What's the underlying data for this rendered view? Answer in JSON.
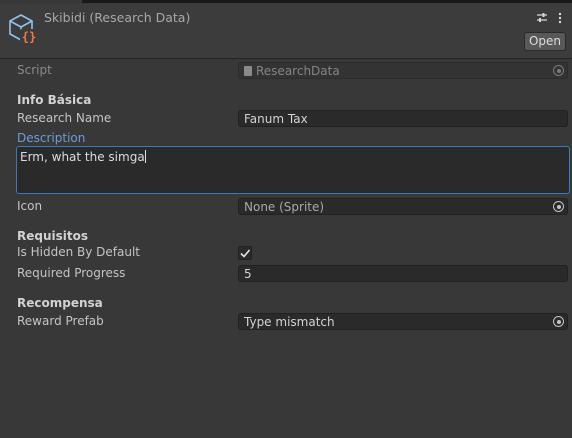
{
  "header": {
    "title": "Skibidi (Research Data)",
    "open_label": "Open",
    "icons": [
      "script-asset-icon",
      "sliders-icon",
      "kebab-menu-icon"
    ]
  },
  "script_row": {
    "label": "Script",
    "value": "ResearchData"
  },
  "sections": {
    "info": "Info Básica",
    "requisitos": "Requisitos",
    "recompensa": "Recompensa"
  },
  "fields": {
    "research_name": {
      "label": "Research Name",
      "value": "Fanum Tax"
    },
    "description": {
      "label": "Description",
      "value": "Erm, what the simga"
    },
    "icon": {
      "label": "Icon",
      "value": "None (Sprite)"
    },
    "is_hidden_by_default": {
      "label": "Is Hidden By Default",
      "checked": true
    },
    "required_progress": {
      "label": "Required Progress",
      "value": "5"
    },
    "reward_prefab": {
      "label": "Reward Prefab",
      "value": "Type mismatch"
    }
  },
  "colors": {
    "background": "#383838",
    "focus_border": "#3a79bb",
    "label_active": "#6d9dd6"
  }
}
